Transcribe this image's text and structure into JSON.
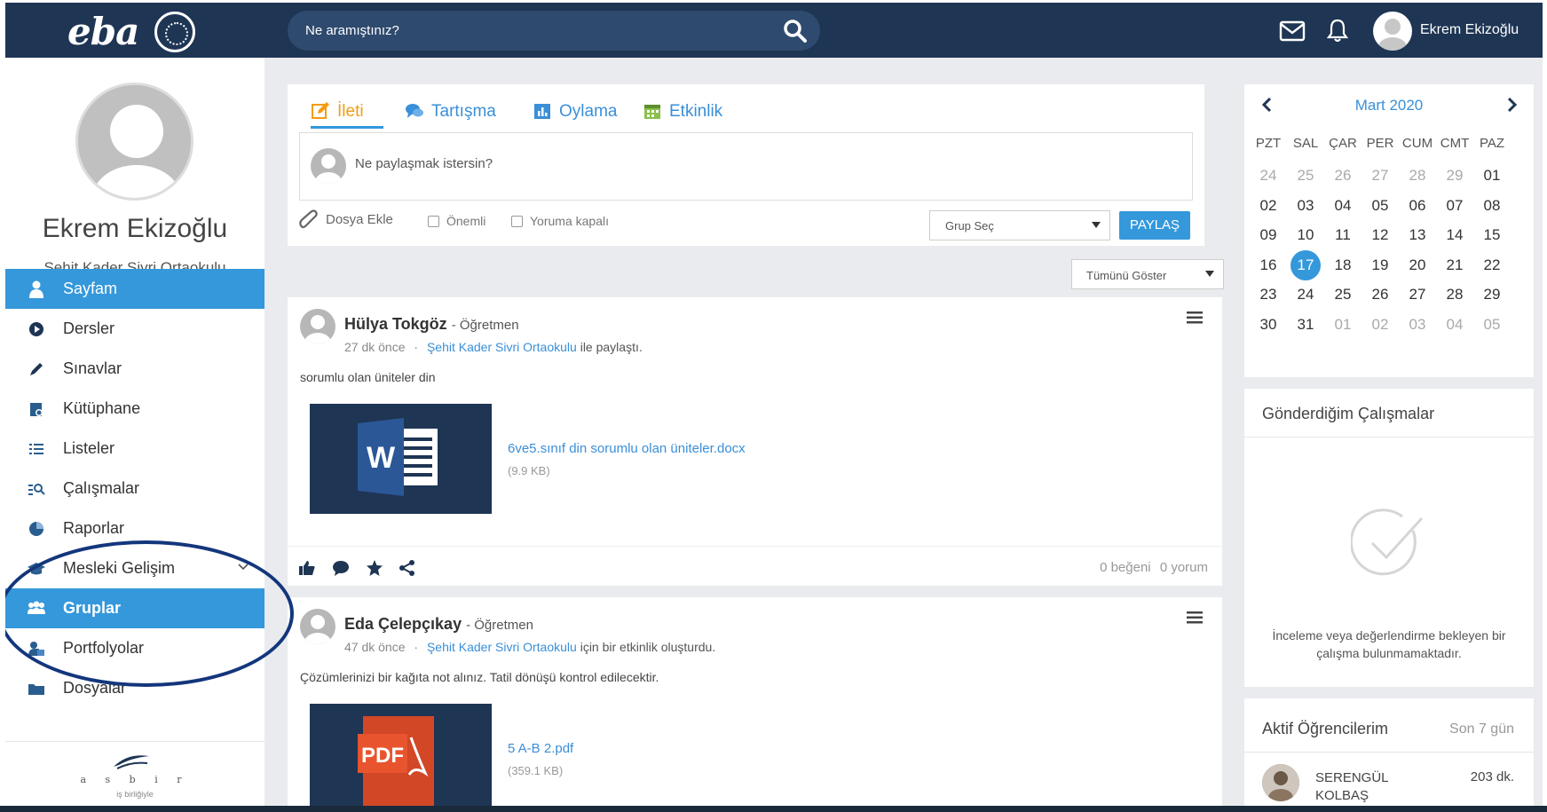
{
  "header": {
    "logo_text": "eba",
    "search_placeholder": "Ne aramıştınız?",
    "user_name": "Ekrem Ekizoğlu"
  },
  "profile": {
    "name": "Ekrem Ekizoğlu",
    "school": "Şehit Kader Sivri Ortaokulu"
  },
  "sidebar": {
    "items": [
      {
        "label": "Sayfam",
        "icon": "person-icon",
        "active": true
      },
      {
        "label": "Dersler",
        "icon": "play-circle-icon"
      },
      {
        "label": "Sınavlar",
        "icon": "pencil-icon"
      },
      {
        "label": "Kütüphane",
        "icon": "library-icon"
      },
      {
        "label": "Listeler",
        "icon": "list-icon"
      },
      {
        "label": "Çalışmalar",
        "icon": "search-list-icon"
      },
      {
        "label": "Raporlar",
        "icon": "chart-icon"
      },
      {
        "label": "Mesleki Gelişim",
        "icon": "graduation-cap-icon"
      },
      {
        "label": "Gruplar",
        "icon": "group-icon",
        "active": true
      },
      {
        "label": "Portfolyolar",
        "icon": "portfolio-icon"
      },
      {
        "label": "Dosyalar",
        "icon": "folder-icon"
      }
    ],
    "footer_brand": "a s b i r",
    "footer_tagline": "iş birliğiyle"
  },
  "composer": {
    "tabs": [
      "İleti",
      "Tartışma",
      "Oylama",
      "Etkinlik"
    ],
    "placeholder": "Ne paylaşmak istersin?",
    "attach_label": "Dosya Ekle",
    "important_label": "Önemli",
    "comments_closed_label": "Yoruma kapalı",
    "group_select": "Grup Seç",
    "share_button": "PAYLAŞ"
  },
  "feed_filter": "Tümünü Göster",
  "posts": [
    {
      "author": "Hülya Tokgöz",
      "role": "- Öğretmen",
      "time": "27 dk önce",
      "separator": "·",
      "target": "Şehit Kader Sivri Ortaokulu",
      "action": "ile paylaştı.",
      "text": "sorumlu olan üniteler din",
      "file_name": "6ve5.sınıf din sorumlu olan üniteler.docx",
      "file_size": "(9.9 KB)",
      "file_type": "word",
      "likes": "0 beğeni",
      "comments": "0 yorum"
    },
    {
      "author": "Eda Çelepçıkay",
      "role": "- Öğretmen",
      "time": "47 dk önce",
      "separator": "·",
      "target": "Şehit Kader Sivri Ortaokulu",
      "action": "için bir etkinlik oluşturdu.",
      "text": "Çözümlerinizi bir kağıta not alınız. Tatil dönüşü kontrol edilecektir.",
      "file_name": "5 A-B 2.pdf",
      "file_size": "(359.1 KB)",
      "file_type": "pdf",
      "pdf_label": "PDF"
    }
  ],
  "calendar": {
    "title": "Mart 2020",
    "weekdays": [
      "PZT",
      "SAL",
      "ÇAR",
      "PER",
      "CUM",
      "CMT",
      "PAZ"
    ],
    "weeks": [
      [
        "24",
        "25",
        "26",
        "27",
        "28",
        "29",
        "01"
      ],
      [
        "02",
        "03",
        "04",
        "05",
        "06",
        "07",
        "08"
      ],
      [
        "09",
        "10",
        "11",
        "12",
        "13",
        "14",
        "15"
      ],
      [
        "16",
        "17",
        "18",
        "19",
        "20",
        "21",
        "22"
      ],
      [
        "23",
        "24",
        "25",
        "26",
        "27",
        "28",
        "29"
      ],
      [
        "30",
        "31",
        "01",
        "02",
        "03",
        "04",
        "05"
      ]
    ],
    "today": "17",
    "accent_color": "#3498db"
  },
  "sent_works": {
    "title": "Gönderdiğim Çalışmalar",
    "empty_text": "İnceleme veya değerlendirme bekleyen bir çalışma bulunmamaktadır."
  },
  "active_students": {
    "title": "Aktif Öğrencilerim",
    "range": "Son 7 gün",
    "students": [
      {
        "name": "SERENGÜL KOLBAŞ",
        "time": "203 dk."
      }
    ]
  }
}
